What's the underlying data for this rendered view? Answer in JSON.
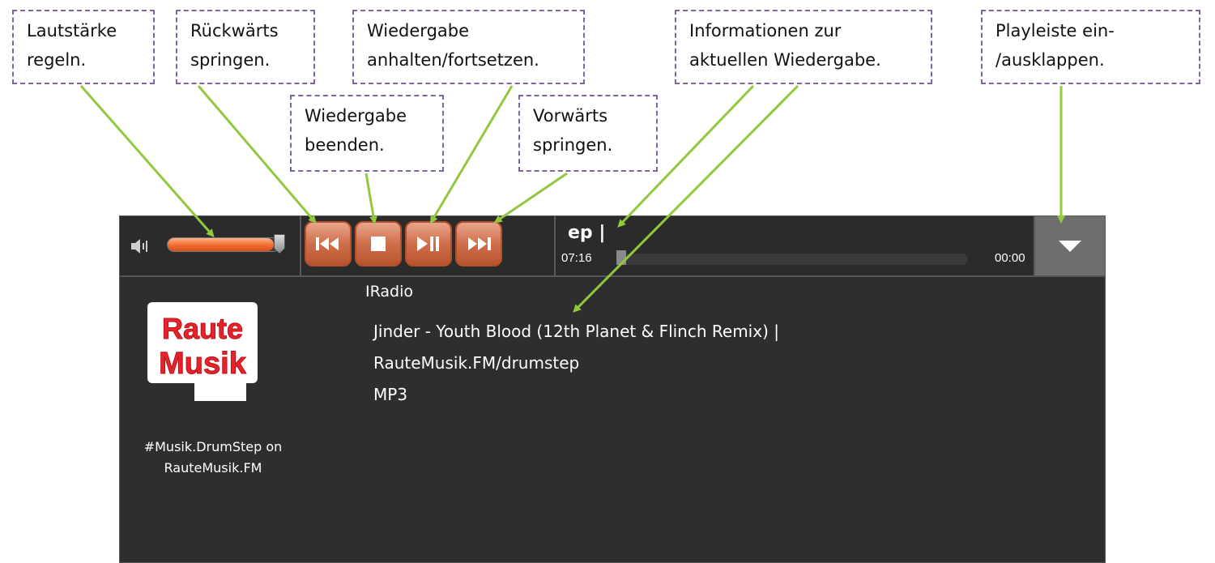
{
  "callouts": {
    "volume": "Lautstärke\nregeln.",
    "back": "Rückwärts\nspringen.",
    "play": "Wiedergabe\nanhalten/fortsetzen.",
    "info": "Informationen zur\naktuellen Wiedergabe.",
    "playlist": "Playleiste ein-\n/ausklappen.",
    "stop": "Wiedergabe\nbeenden.",
    "forward": "Vorwärts\nspringen."
  },
  "player": {
    "volume_level": 0.95,
    "now_playing_title": "ep  |",
    "time_elapsed": "07:16",
    "time_total": "00:00",
    "progress": 0.0,
    "controls": [
      "skip-back-icon",
      "stop-icon",
      "play-pause-icon",
      "skip-forward-icon"
    ],
    "playlist_toggle_icon": "triangle-down-icon"
  },
  "content": {
    "source": "IRadio",
    "track": "Jinder - Youth Blood (12th Planet & Flinch Remix) |",
    "station_url": "RauteMusik.FM/drumstep",
    "format": "MP3",
    "logo_text": "RauteMusik",
    "station_name": "#Musik.DrumStep on\nRauteMusik.FM"
  },
  "colors": {
    "callout_border": "#8064a2",
    "arrow": "#92c83e",
    "accent": "#f26a2e",
    "panel": "#2e2e2e"
  }
}
